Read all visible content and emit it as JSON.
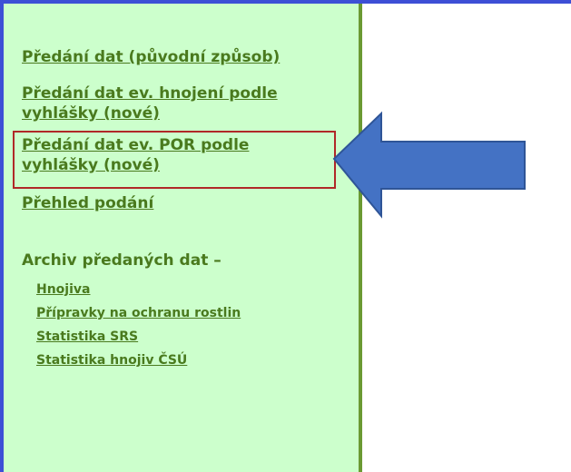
{
  "sidebar": {
    "links": [
      {
        "label": "Předání dat (původní způsob)"
      },
      {
        "label": "Předání dat ev. hnojení podle vyhlášky (nové)"
      },
      {
        "label": "Předání dat ev. POR podle vyhlášky (nové)"
      },
      {
        "label": "Přehled podání"
      }
    ],
    "archive": {
      "heading": "Archiv předaných dat –",
      "items": [
        {
          "label": "Hnojiva"
        },
        {
          "label": "Přípravky na ochranu rostlin"
        },
        {
          "label": "Statistika SRS"
        },
        {
          "label": "Statistika hnojiv ČSÚ"
        }
      ]
    }
  },
  "colors": {
    "sidebar_bg": "#ccffcc",
    "link": "#4a7a1e",
    "frame": "#3d4fd6",
    "highlight": "#b02828",
    "arrow": "#4472c4"
  },
  "annotations": {
    "arrow": "arrow-left-icon"
  }
}
